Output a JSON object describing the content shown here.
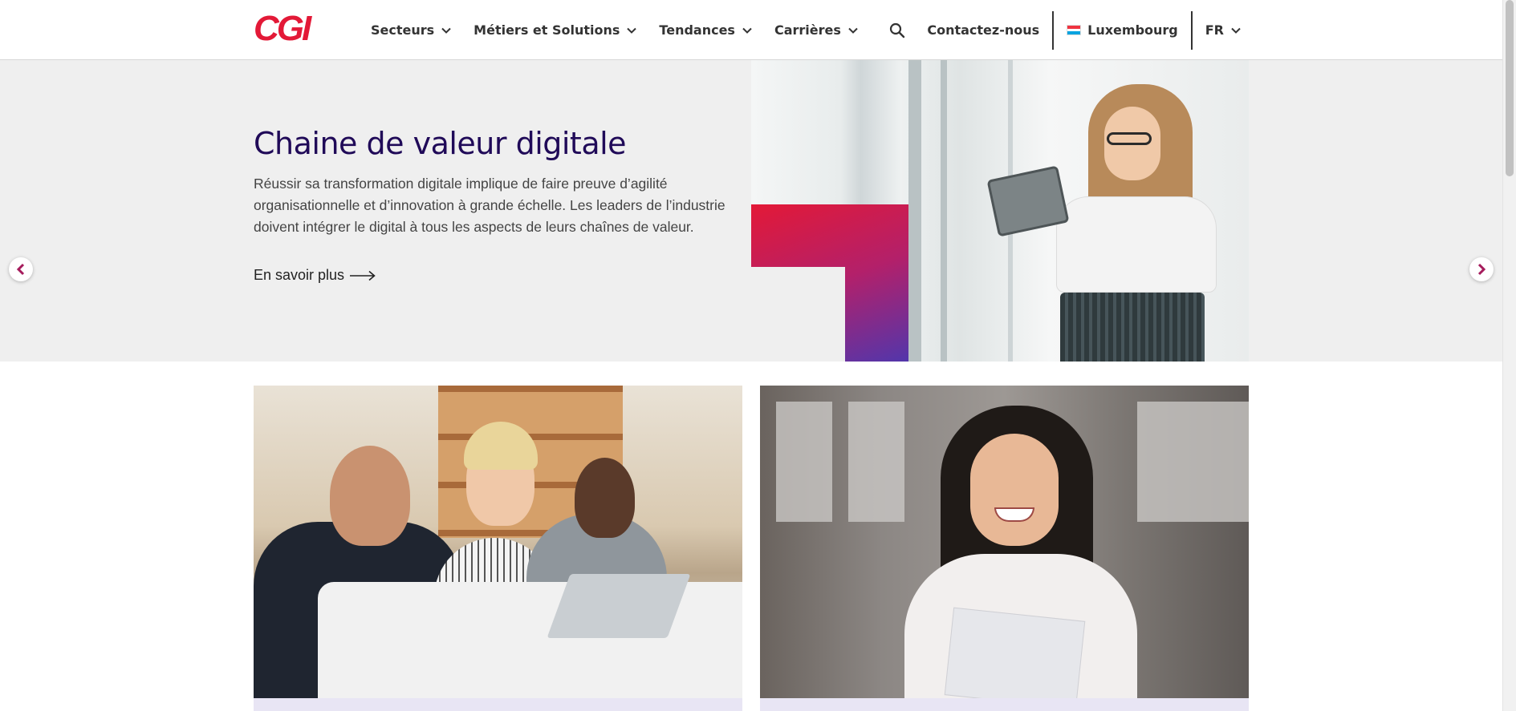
{
  "header": {
    "logo": "CGI",
    "nav": [
      {
        "label": "Secteurs"
      },
      {
        "label": "Métiers et Solutions"
      },
      {
        "label": "Tendances"
      },
      {
        "label": "Carrières"
      }
    ],
    "search_icon": "search-icon",
    "contact_label": "Contactez-nous",
    "country_label": "Luxembourg",
    "language_label": "FR"
  },
  "hero": {
    "title": "Chaine de valeur digitale",
    "description": "Réussir sa transformation digitale implique de faire preuve d’agilité organisationnelle et d’innovation à grande échelle. Les leaders de l’industrie doivent intégrer le digital à tous les aspects de leurs chaînes de valeur.",
    "link_label": "En savoir plus"
  },
  "colors": {
    "brand_red": "#e31937",
    "brand_purple": "#5236ab",
    "title_navy": "#200a58",
    "chevron": "#a51b5c"
  }
}
